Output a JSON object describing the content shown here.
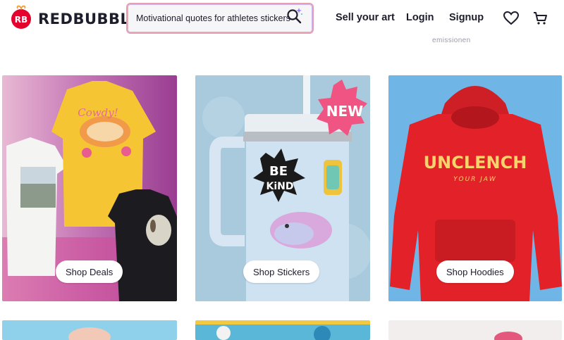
{
  "brand": {
    "name": "REDBUBBLE",
    "color": "#e4032e"
  },
  "search": {
    "value": "Motivational quotes for athletes stickers"
  },
  "nav": {
    "sell": "Sell your art",
    "login": "Login",
    "signup": "Signup"
  },
  "faint_text": "emissionen",
  "cards": [
    {
      "label": "Shop Deals"
    },
    {
      "label": "Shop Stickers",
      "badge": "NEW",
      "sticker_text": [
        "BE",
        "KiND"
      ]
    },
    {
      "label": "Shop Hoodies",
      "hoodie_text": "UNCLENCH",
      "hoodie_subtext": "YOUR JAW"
    }
  ],
  "icons": {
    "wishlist": "heart-icon",
    "cart": "cart-icon",
    "search": "search-icon"
  }
}
